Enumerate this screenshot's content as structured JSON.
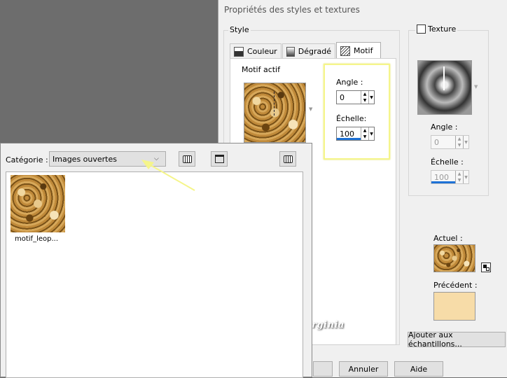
{
  "dialog": {
    "title": "Propriétés des styles et textures",
    "style_group": "Style",
    "tabs": [
      {
        "label": "Couleur"
      },
      {
        "label": "Dégradé"
      },
      {
        "label": "Motif"
      }
    ],
    "motif_actif_label": "Motif actif",
    "angle_label": "Angle :",
    "angle_value": "0",
    "echelle_label": "Échelle:",
    "echelle_value": "100",
    "texture_label": "Texture",
    "texture_angle_label": "Angle :",
    "texture_angle_value": "0",
    "texture_echelle_label": "Échelle :",
    "texture_echelle_value": "100",
    "actuel_label": "Actuel :",
    "precedent_label": "Précédent :",
    "add_swatches_label": "Ajouter aux échantillons...",
    "cancel_label": "Annuler",
    "help_label": "Aide",
    "colors": {
      "highlight": "#f5f58a",
      "precedent_swatch": "#f7dca8"
    }
  },
  "popup": {
    "category_label": "Catégorie :",
    "category_value": "Images ouvertes",
    "items": [
      {
        "label": "motif_leop..."
      }
    ]
  },
  "watermark": "© Créations Virginia"
}
